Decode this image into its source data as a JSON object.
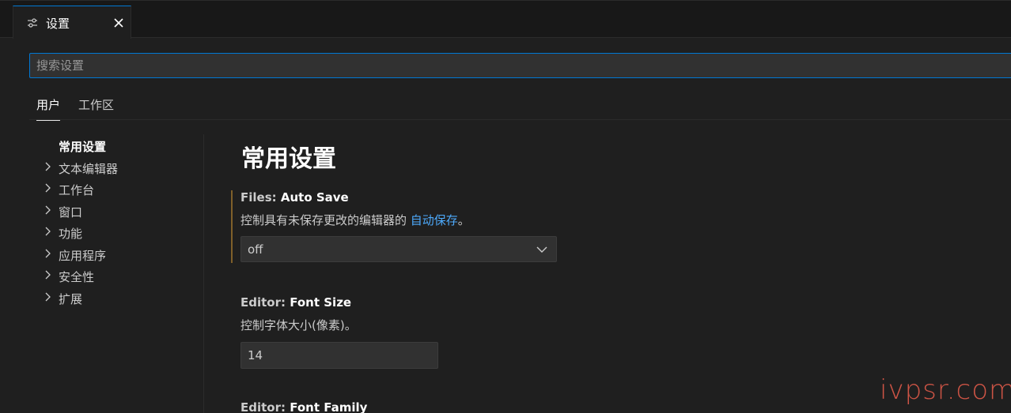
{
  "tab": {
    "label": "设置",
    "icon": "settings-sliders-icon",
    "close_icon": "close-icon"
  },
  "search": {
    "placeholder": "搜索设置",
    "value": ""
  },
  "scope_tabs": [
    {
      "label": "用户",
      "active": true
    },
    {
      "label": "工作区",
      "active": false
    }
  ],
  "toc": {
    "items": [
      {
        "label": "常用设置",
        "active": true,
        "expandable": false
      },
      {
        "label": "文本编辑器",
        "active": false,
        "expandable": true
      },
      {
        "label": "工作台",
        "active": false,
        "expandable": true
      },
      {
        "label": "窗口",
        "active": false,
        "expandable": true
      },
      {
        "label": "功能",
        "active": false,
        "expandable": true
      },
      {
        "label": "应用程序",
        "active": false,
        "expandable": true
      },
      {
        "label": "安全性",
        "active": false,
        "expandable": true
      },
      {
        "label": "扩展",
        "active": false,
        "expandable": true
      }
    ]
  },
  "main": {
    "section_title": "常用设置",
    "settings": [
      {
        "category": "Files: ",
        "key": "Auto Save",
        "description_prefix": "控制具有未保存更改的编辑器的 ",
        "description_link": "自动保存",
        "description_suffix": "。",
        "control": "select",
        "value": "off",
        "modified": true
      },
      {
        "category": "Editor: ",
        "key": "Font Size",
        "description": "控制字体大小(像素)。",
        "control": "text",
        "value": "14",
        "modified": false
      },
      {
        "category": "Editor: ",
        "key": "Font Family"
      }
    ]
  },
  "watermark": "ivpsr.com",
  "colors": {
    "accent": "#0078d4",
    "link": "#4daafc",
    "modified_indicator": "#7f5f2a",
    "background": "#1f1f1f",
    "watermark": "#e05a4a"
  }
}
